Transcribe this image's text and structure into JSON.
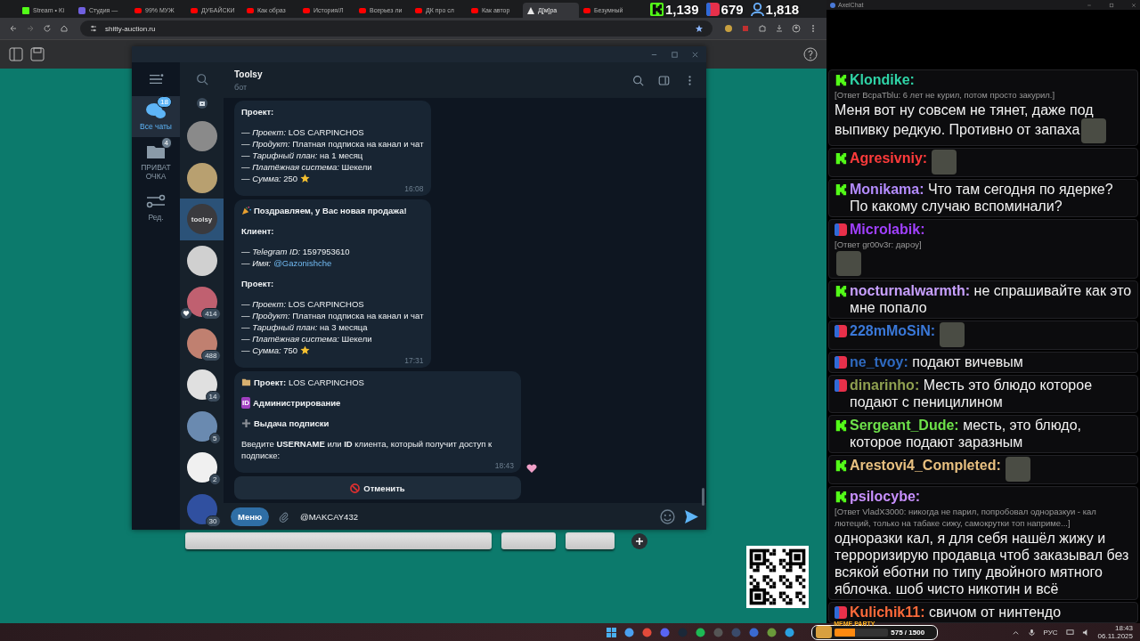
{
  "browser": {
    "tabs": [
      {
        "label": "Stream • Ki",
        "kind": "kick",
        "selected": false
      },
      {
        "label": "Студия —",
        "kind": "studio",
        "selected": false
      },
      {
        "label": "99% МУЖ",
        "kind": "video",
        "selected": false
      },
      {
        "label": "ДУБАЙСКИ",
        "kind": "video",
        "selected": false
      },
      {
        "label": "Как образ",
        "kind": "video",
        "selected": false
      },
      {
        "label": "История/Л",
        "kind": "video",
        "selected": false
      },
      {
        "label": "Всерьез ли",
        "kind": "video",
        "selected": false
      },
      {
        "label": "ДК про сл",
        "kind": "video",
        "selected": false
      },
      {
        "label": "Как автор",
        "kind": "video",
        "selected": false
      },
      {
        "label": "Д[м]ра",
        "kind": "site",
        "selected": true
      },
      {
        "label": "Безумный",
        "kind": "video",
        "selected": false
      }
    ],
    "url": "shitty-auction.ru"
  },
  "stream_stats": [
    {
      "kind": "kick",
      "value": "1,139"
    },
    {
      "kind": "live",
      "value": "679"
    },
    {
      "kind": "viewers",
      "value": "1,818"
    }
  ],
  "telegram": {
    "folders": [
      {
        "label": "Все чаты",
        "badge": "18",
        "kind": "chats",
        "selected": true
      },
      {
        "label": "ПРИВАТ ОЧКА",
        "badge": "4",
        "kind": "folder",
        "selected": false
      },
      {
        "label": "Ред.",
        "kind": "edit",
        "selected": false
      }
    ],
    "chats": [
      {
        "kind": "photo",
        "selected": false,
        "reaction": false
      },
      {
        "kind": "photo",
        "selected": false,
        "reaction": false
      },
      {
        "kind": "logo",
        "logo_text": "toolsy",
        "selected": true,
        "reaction": false
      },
      {
        "kind": "photo",
        "selected": false,
        "reaction": false
      },
      {
        "kind": "photo",
        "selected": false,
        "reaction": true,
        "badge": "414"
      },
      {
        "kind": "photo",
        "selected": false,
        "reaction": false,
        "badge": "488"
      },
      {
        "kind": "photo",
        "selected": false,
        "reaction": false,
        "badge": "14"
      },
      {
        "kind": "photo",
        "selected": false,
        "reaction": false,
        "badge": "5"
      },
      {
        "kind": "photo",
        "selected": false,
        "reaction": false,
        "badge": "2"
      },
      {
        "kind": "photo",
        "selected": false,
        "reaction": false,
        "badge": "30"
      }
    ],
    "chat": {
      "title": "Toolsy",
      "subtitle": "бот",
      "messages": [
        {
          "paragraphs": [
            [
              {
                "kind": "bold",
                "text": "Проект:"
              }
            ],
            [
              {
                "kind": "line",
                "text": "— *Проект:* LOS CARPINCHOS"
              },
              {
                "kind": "line",
                "text": "— *Продукт:* Платная подписка на канал и чат"
              },
              {
                "kind": "line",
                "text": "— *Тарифный план:* на 1 месяц"
              },
              {
                "kind": "line",
                "text": "— *Платёжная система:* Шекели"
              },
              {
                "kind": "amount",
                "text": "— *Сумма:* 250"
              }
            ]
          ],
          "time": "16:08",
          "reaction": false
        },
        {
          "paragraphs": [
            [
              {
                "kind": "announce",
                "text": "Поздравляем, у Вас новая продажа!"
              }
            ],
            [
              {
                "kind": "bold",
                "text": "Клиент:"
              }
            ],
            [
              {
                "kind": "line",
                "text": "— *Telegram ID:* 1597953610"
              },
              {
                "kind": "line",
                "text": "— *Имя:*",
                "link": "@Gazonishche"
              }
            ],
            [
              {
                "kind": "bold",
                "text": "Проект:"
              }
            ],
            [
              {
                "kind": "line",
                "text": "— *Проект:* LOS CARPINCHOS"
              },
              {
                "kind": "line",
                "text": "— *Продукт:* Платная подписка на канал и чат"
              },
              {
                "kind": "line",
                "text": "— *Тарифный план:* на 3 месяца"
              },
              {
                "kind": "line",
                "text": "— *Платёжная система:* Шекели"
              },
              {
                "kind": "amount",
                "text": "— *Сумма:* 750"
              }
            ]
          ],
          "time": "17:31",
          "reaction": false
        },
        {
          "paragraphs": [
            [
              {
                "kind": "project",
                "text": "**Проект:** LOS CARPINCHOS"
              }
            ],
            [
              {
                "kind": "admin",
                "text": "Администрирование",
                "badge": "ID"
              }
            ],
            [
              {
                "kind": "action",
                "text": "Выдача подписки"
              }
            ],
            [
              {
                "kind": "line",
                "text": "Введите **USERNAME** или **ID** клиента, который получит доступ к подписке:"
              }
            ]
          ],
          "time": "18:43",
          "reaction": true
        }
      ],
      "cancel_button": "Отменить",
      "menu_button": "Меню",
      "input_value": "@MAKCAY432"
    }
  },
  "live_chat": {
    "title": "AxelChat",
    "messages": [
      {
        "kind": "kick",
        "user": "Klondike:",
        "color": "#2fd3a6",
        "reply": "[Ответ BcpaTblu: 6 лет не курил, потом просто закурил.]",
        "text": "Меня вот ну совсем не тянет, даже под выпивку редкую. Противно от запаха",
        "emote": true
      },
      {
        "kind": "kick",
        "user": "Agresivniy:",
        "color": "#ff3b3b",
        "emote": true
      },
      {
        "kind": "kick",
        "user": "Monikama:",
        "color": "#b48cff",
        "text": "Что там сегодня по ядерке? По какому случаю вспоминали?",
        "emote": false
      },
      {
        "kind": "live",
        "user": "Microlabik:",
        "color": "#a040ff",
        "reply": "[Ответ gr00v3r: дарoy]",
        "emote": true
      },
      {
        "kind": "kick",
        "user": "nocturnalwarmth:",
        "color": "#c8a0ff",
        "text": "не спрашивайте как это мне попало",
        "emote": false
      },
      {
        "kind": "live",
        "user": "228mMoSiN:",
        "color": "#3a78d8",
        "emote": true
      },
      {
        "kind": "live",
        "user": "ne_tvoy:",
        "color": "#2f6ac0",
        "text": "подают вичевым",
        "emote": false
      },
      {
        "kind": "live",
        "user": "dinarinho:",
        "color": "#8fa050",
        "text": "Месть это блюдо которое подают с пеницилином",
        "emote": false
      },
      {
        "kind": "kick",
        "user": "Sergeant_Dude:",
        "color": "#6ee24a",
        "text": "месть, это блюдо, которое подают заразным",
        "emote": false
      },
      {
        "kind": "kick",
        "user": "Arestovi4_Completed:",
        "color": "#e8c080",
        "emote": true
      },
      {
        "kind": "kick",
        "user": "psilocybe:",
        "color": "#c890ff",
        "reply": "[Ответ VladX3000: никогда не парил, попробовал одноразкуи - кал лютеций, только на табаке сижу, самокрутки топ наприме...]",
        "text": "одноразки кал, я для себя нашёл жижу и терроризирую продавца чтоб заказывал без всякой еботни по типу двойного мятного яблочка. шоб чисто никотин и всё",
        "emote": false
      },
      {
        "kind": "live",
        "user": "Kulichik11:",
        "color": "#ff6a3a",
        "text": "свичом от нинтендо",
        "emote": false
      }
    ]
  },
  "meme_party": {
    "title": "MEME PARTY",
    "progress": "575 / 1500",
    "level": 0.38
  },
  "tray": {
    "language": "РУС",
    "time": "18:43",
    "date": "06.11.2025"
  }
}
